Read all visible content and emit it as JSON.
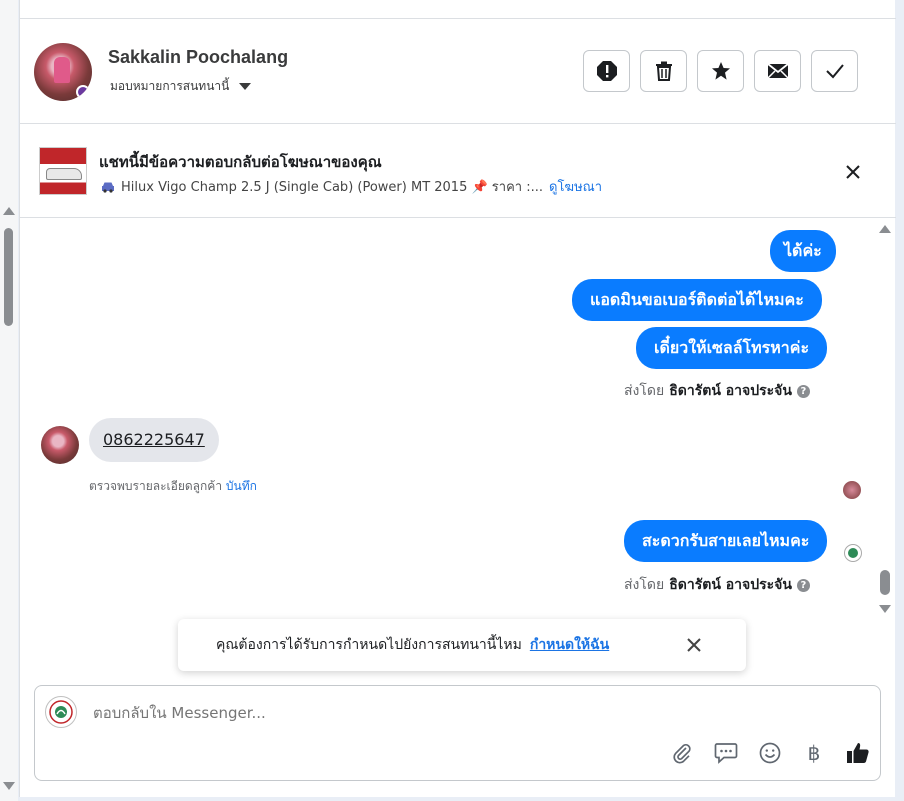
{
  "header": {
    "contact_name": "Sakkalin Poochalang",
    "assign_label": "มอบหมายการสนทนานี้",
    "buttons": [
      "spam-icon",
      "trash-icon",
      "star-icon",
      "mail-icon",
      "check-icon"
    ]
  },
  "ad": {
    "title": "แชทนี้มีข้อความตอบกลับต่อโฆษณาของคุณ",
    "description": "Hilux Vigo Champ 2.5 J (Single Cab) (Power) MT 2015 📌 ราคา :...",
    "view_link": "ดูโฆษณา"
  },
  "messages": {
    "out1": "ได้ค่ะ",
    "out2": "แอดมินขอเบอร์ติดต่อได้ไหมคะ",
    "out3": "เดี๋ยวให้เซลล์โทรหาค่ะ",
    "sent_by_prefix": "ส่งโดย",
    "sent_by_name": "ธิดารัตน์ อาจประจัน",
    "in1": "0862225647",
    "detect_text": "ตรวจพบรายละเอียดลูกค้า",
    "detect_link": "บันทึก",
    "out4": "สะดวกรับสายเลยไหมคะ"
  },
  "toast": {
    "text": "คุณต้องการได้รับการกำหนดไปยังการสนทนานี้ไหม",
    "link": "กำหนดให้ฉัน"
  },
  "composer": {
    "placeholder": "ตอบกลับใน Messenger...",
    "currency_symbol": "฿"
  },
  "colors": {
    "accent": "#0a7cff",
    "link": "#1b74e4"
  }
}
